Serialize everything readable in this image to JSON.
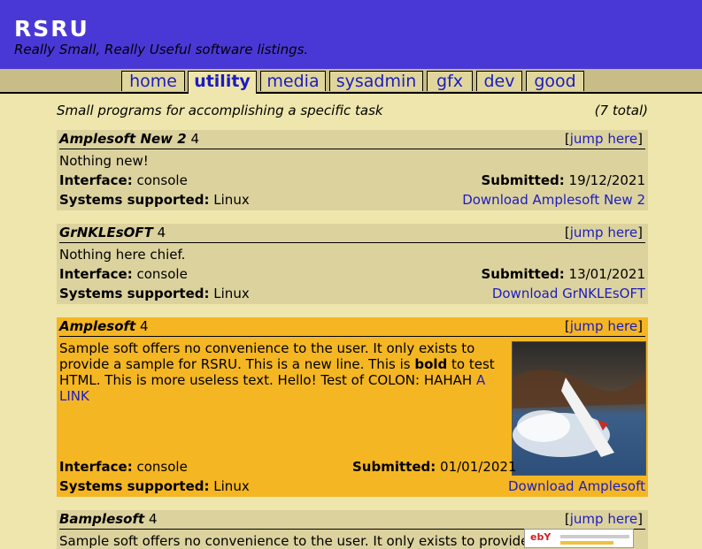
{
  "site": {
    "title": "RSRU",
    "tagline": "Really Small, Really Useful software listings."
  },
  "tabs": [
    {
      "label": "home"
    },
    {
      "label": "utility"
    },
    {
      "label": "media"
    },
    {
      "label": "sysadmin"
    },
    {
      "label": "gfx"
    },
    {
      "label": "dev"
    },
    {
      "label": "good"
    }
  ],
  "section": {
    "description": "Small programs for accomplishing a specific task",
    "total": "(7 total)"
  },
  "labels": {
    "jump": "jump here",
    "interface": "Interface:",
    "systems": "Systems supported:",
    "submitted": "Submitted:"
  },
  "entries": [
    {
      "name": "Amplesoft New 2",
      "rating": "4",
      "description": "Nothing new!",
      "interface": "console",
      "submitted": "19/12/2021",
      "systems": "Linux",
      "download": "Download Amplesoft New 2"
    },
    {
      "name": "GrNKLEsOFT",
      "rating": "4",
      "description": "Nothing here chief.",
      "interface": "console",
      "submitted": "13/01/2021",
      "systems": "Linux",
      "download": "Download GrNKLEsOFT"
    },
    {
      "name": "Amplesoft",
      "rating": "4",
      "description_pre": "Sample soft offers no convenience to the user. It only exists to provide a sample for RSRU. This is a new line. This is ",
      "description_bold": "bold",
      "description_post": " to test HTML. This is more useless text. Hello! Test of COLON: HAHAH ",
      "description_link": "A LINK",
      "interface": "console",
      "submitted": "01/01/2021",
      "systems": "Linux",
      "download": "Download Amplesoft"
    },
    {
      "name": "Bamplesoft",
      "rating": "4",
      "description": "Sample soft offers no convenience to the user. It only exists to provide"
    }
  ],
  "thumbnail_logo": "ebY"
}
